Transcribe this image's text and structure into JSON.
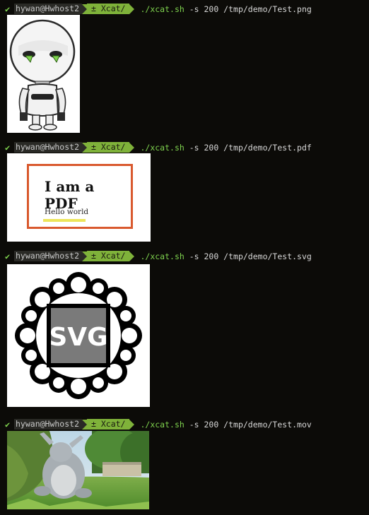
{
  "terminal": {
    "prompts": [
      {
        "status_icon": "check-icon",
        "user_host": "hywan@Hwhost2",
        "directory": "± Xcat/",
        "executable": "./xcat.sh",
        "args": " -s 200 /tmp/demo/Test.png"
      },
      {
        "status_icon": "check-icon",
        "user_host": "hywan@Hwhost2",
        "directory": "± Xcat/",
        "executable": "./xcat.sh",
        "args": " -s 200 /tmp/demo/Test.pdf"
      },
      {
        "status_icon": "check-icon",
        "user_host": "hywan@Hwhost2",
        "directory": "± Xcat/",
        "executable": "./xcat.sh",
        "args": " -s 200 /tmp/demo/Test.svg"
      },
      {
        "status_icon": "check-icon",
        "user_host": "hywan@Hwhost2",
        "directory": "± Xcat/",
        "executable": "./xcat.sh",
        "args": " -s 200 /tmp/demo/Test.mov"
      }
    ],
    "pdf_preview": {
      "title": "I am a PDF",
      "body": "Hello world",
      "frame_color": "#d9592e",
      "highlight_color": "#ece55a"
    },
    "svg_preview": {
      "label": "SVG"
    },
    "colors": {
      "background": "#0c0b08",
      "success": "#7fd34e",
      "segment_user": "#2a2a26",
      "segment_dir": "#7fb23a"
    }
  }
}
